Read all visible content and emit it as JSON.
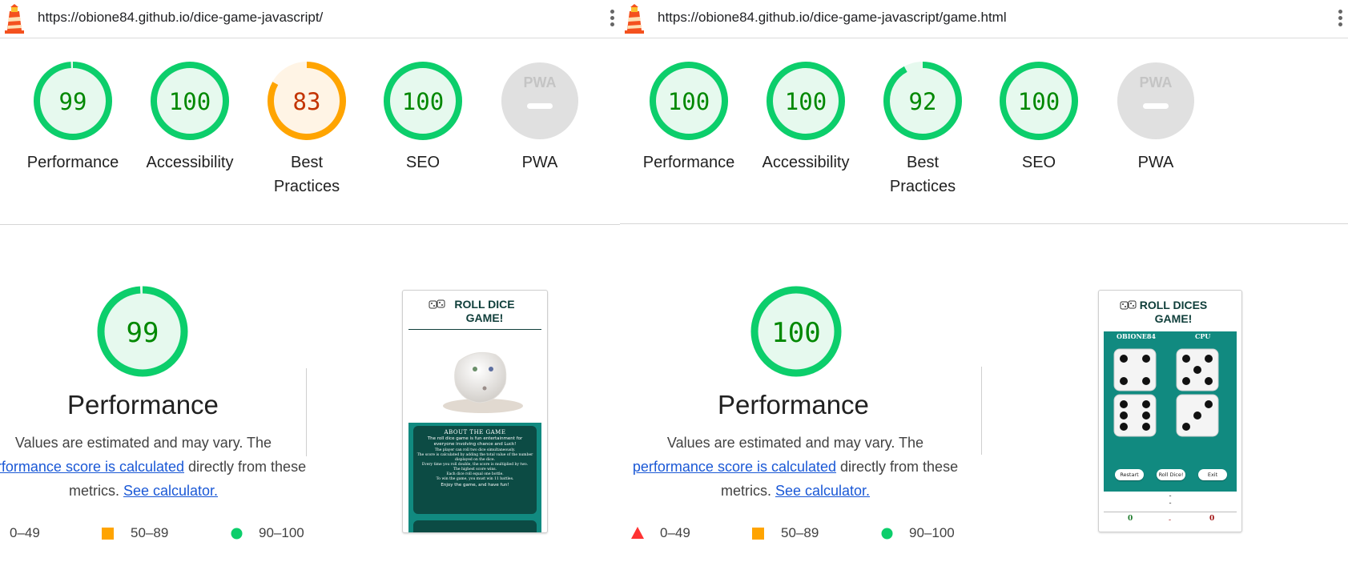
{
  "panels": [
    {
      "url": "https://obione84.github.io/dice-game-javascript/",
      "scores": [
        {
          "value": "99",
          "label": "Performance",
          "score": 0.99,
          "rating": "pass"
        },
        {
          "value": "100",
          "label": "Accessibility",
          "score": 1.0,
          "rating": "pass"
        },
        {
          "value": "83",
          "label": "Best Practices",
          "score": 0.83,
          "rating": "average"
        },
        {
          "value": "100",
          "label": "SEO",
          "score": 1.0,
          "rating": "pass"
        },
        {
          "value": "",
          "label": "PWA",
          "score": 0,
          "rating": "na"
        }
      ],
      "main": {
        "value": "99",
        "score": 0.99,
        "title": "Performance",
        "desc_1": "Values are estimated and may vary. The",
        "desc_link": "performance score is calculated",
        "desc_2": "directly from these",
        "desc_3": "metrics.",
        "desc_calc": "See calculator."
      },
      "legend": {
        "fail": "0–49",
        "average": "50–89",
        "pass": "90–100"
      },
      "screenshot": {
        "title": "ROLL DICE GAME!",
        "about_title": "ABOUT THE GAME",
        "about_intro": "The roll dice game is fun entertainment for everyone involving chance and Luck!",
        "rules": [
          "The player can roll two dice simultaneously.",
          "The score is calculated by adding the total value of the number displayed on the dice.",
          "Every time you roll double, the score is multiplied by two.",
          "The highest score wins.",
          "Each dice roll equal one bottle.",
          "To win the game, you must win 11 battles."
        ],
        "outro": "Enjoy the game, and have fun!"
      }
    },
    {
      "url": "https://obione84.github.io/dice-game-javascript/game.html",
      "scores": [
        {
          "value": "100",
          "label": "Performance",
          "score": 1.0,
          "rating": "pass"
        },
        {
          "value": "100",
          "label": "Accessibility",
          "score": 1.0,
          "rating": "pass"
        },
        {
          "value": "92",
          "label": "Best Practices",
          "score": 0.92,
          "rating": "pass"
        },
        {
          "value": "100",
          "label": "SEO",
          "score": 1.0,
          "rating": "pass"
        },
        {
          "value": "",
          "label": "PWA",
          "score": 0,
          "rating": "na"
        }
      ],
      "main": {
        "value": "100",
        "score": 1.0,
        "title": "Performance",
        "desc_1": "Values are estimated and may vary. The",
        "desc_link": "performance score is calculated",
        "desc_2": "directly from these",
        "desc_3": "metrics.",
        "desc_calc": "See calculator."
      },
      "legend": {
        "fail": "0–49",
        "average": "50–89",
        "pass": "90–100"
      },
      "screenshot": {
        "title": "ROLL DICES GAME!",
        "player": "OBIONE84",
        "cpu": "CPU",
        "dice": [
          4,
          5,
          6,
          3
        ],
        "buttons": [
          "Restart",
          "Roll Dice!",
          "Exit"
        ],
        "dashes": [
          "-",
          "-"
        ],
        "score_player": "0",
        "score_sep": "-",
        "score_cpu": "0"
      }
    }
  ],
  "colors": {
    "pass": "#0cce6b",
    "pass_bg": "#e6f9ee",
    "pass_text": "#008800",
    "average": "#ffa400",
    "average_bg": "#fff4e5",
    "average_text": "#c33300",
    "fail": "#ff3333",
    "na": "#e0e0e0",
    "link": "#1a58d6",
    "teal": "#118a80"
  },
  "icons": {
    "logo": "lighthouse-icon",
    "menu": "kebab-menu-icon",
    "pwa": "pwa-badge-icon",
    "fail": "triangle-icon",
    "average": "square-icon",
    "pass": "circle-icon"
  }
}
